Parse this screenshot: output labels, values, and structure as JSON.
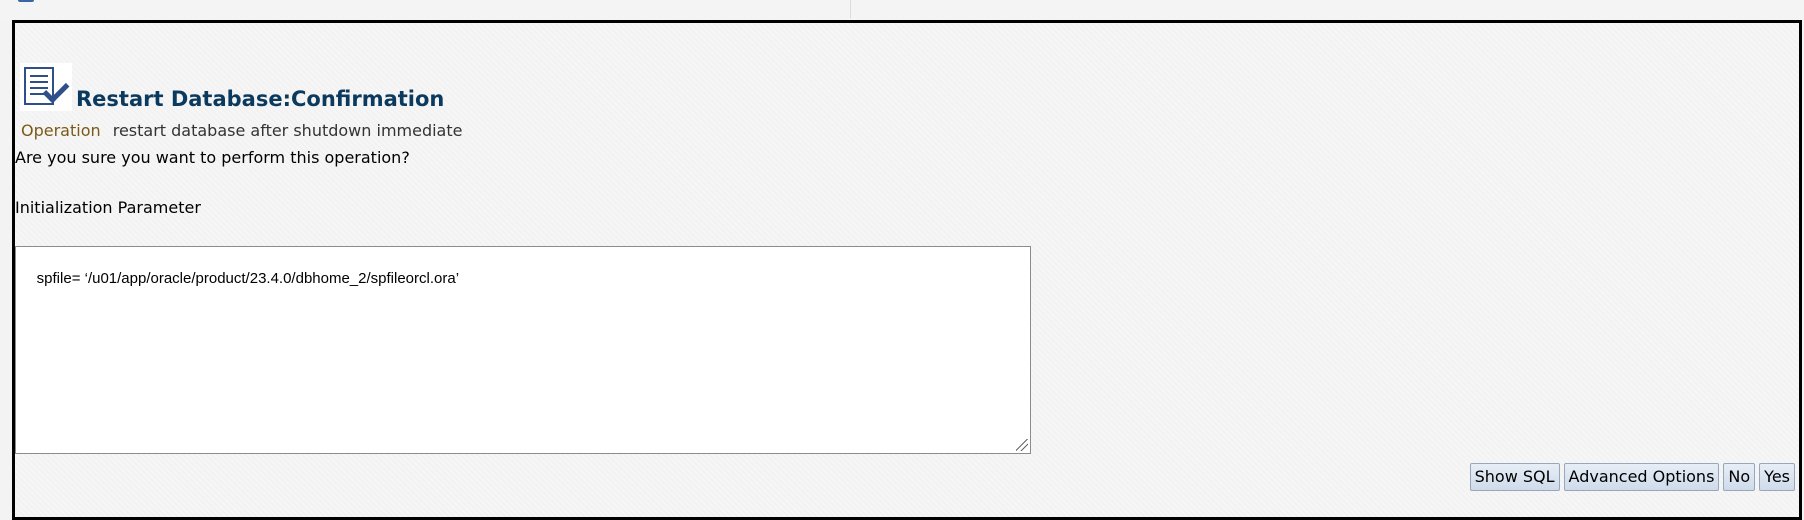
{
  "dialog": {
    "title": "Restart Database:Confirmation",
    "operation_label": "Operation",
    "operation_value": "restart database after shutdown immediate",
    "question": "Are you sure you want to perform this operation?",
    "parameter_label": "Initialization Parameter",
    "parameter_value": "spfile= ‘/u01/app/oracle/product/23.4.0/dbhome_2/spfileorcl.ora’"
  },
  "buttons": {
    "show_sql": "Show SQL",
    "advanced_options": "Advanced Options",
    "no": "No",
    "yes": "Yes"
  },
  "icons": {
    "header": "confirmation-document-check-icon"
  },
  "colors": {
    "title": "#0c3a5e",
    "operation_label": "#7a5a17",
    "button_gradient_top": "#e7eef7",
    "button_gradient_bottom": "#cfdbea"
  }
}
